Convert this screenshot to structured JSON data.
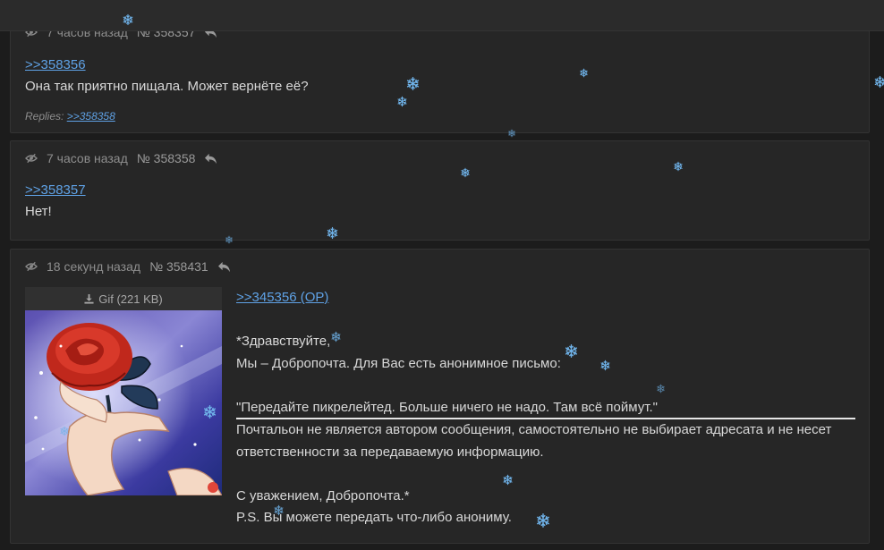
{
  "posts": [
    {
      "time": "7 часов назад",
      "number": "№ 358357",
      "quote_link": ">>358356",
      "text": "Она так приятно пищала. Может вернёте её?",
      "replies_label": "Replies:",
      "replies_link": ">>358358"
    },
    {
      "time": "7 часов назад",
      "number": "№ 358358",
      "quote_link": ">>358357",
      "text": "Нет!"
    },
    {
      "time": "18 секунд назад",
      "number": "№ 358431",
      "file_label": "Gif (221 KB)",
      "quote_link": ">>345356 (OP)",
      "lines": [
        "*Здравствуйте,",
        "Мы – Добропочта. Для Вас есть анонимное письмо:",
        "\"Передайте пикрелейтед. Больше ничего не надо. Там всё поймут.\"",
        "Почтальон не является автором сообщения, самостоятельно не выбирает адресата и не несет ответственности за передаваемую информацию.",
        "С уважением, Добропочта.*",
        "P.S. Вы можете передать что-либо анониму."
      ]
    }
  ],
  "icons": {
    "hide": "eye-slash-icon",
    "reply": "reply-arrow-icon",
    "download": "download-icon",
    "snowflake": "snowflake-icon"
  },
  "colors": {
    "background": "#1c1c1c",
    "post_background": "#262626",
    "link": "#5fa2e6",
    "text": "#d8d8d8",
    "meta": "#8e8e8e",
    "snow": "#6fb2e8"
  }
}
